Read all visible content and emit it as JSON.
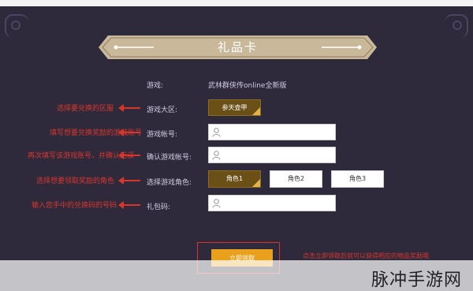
{
  "title": "礼品卡",
  "form": {
    "game_label": "游戏:",
    "game_value": "武林群侠传online全新版",
    "server_label": "游戏大区:",
    "server_value": "参天壶甲",
    "account_label": "游戏帐号:",
    "account_value": "",
    "confirm_label": "确认游戏帐号:",
    "confirm_value": "",
    "role_label": "选择游戏角色:",
    "roles": [
      "角色1",
      "角色2",
      "角色3"
    ],
    "code_label": "礼包码:",
    "code_value": ""
  },
  "notes": {
    "server": "选择要兑换的区服",
    "account": "填写想要兑换奖励的游戏账号",
    "confirm": "再次填写该游戏账号，并确认无误",
    "role": "选择想要领取奖励的角色",
    "code": "输入您手中的兑换码的号码"
  },
  "claim": {
    "label": "立即领取",
    "note": "点击立即领取后就可以获得相应的物品奖励哦"
  },
  "watermark": "脉冲手游网",
  "colors": {
    "panel": "#2e2a3c",
    "banner": "#c9b99a",
    "accent_red": "#d9362b",
    "gold": "#6a4f17",
    "claim": "#e8a01d"
  }
}
